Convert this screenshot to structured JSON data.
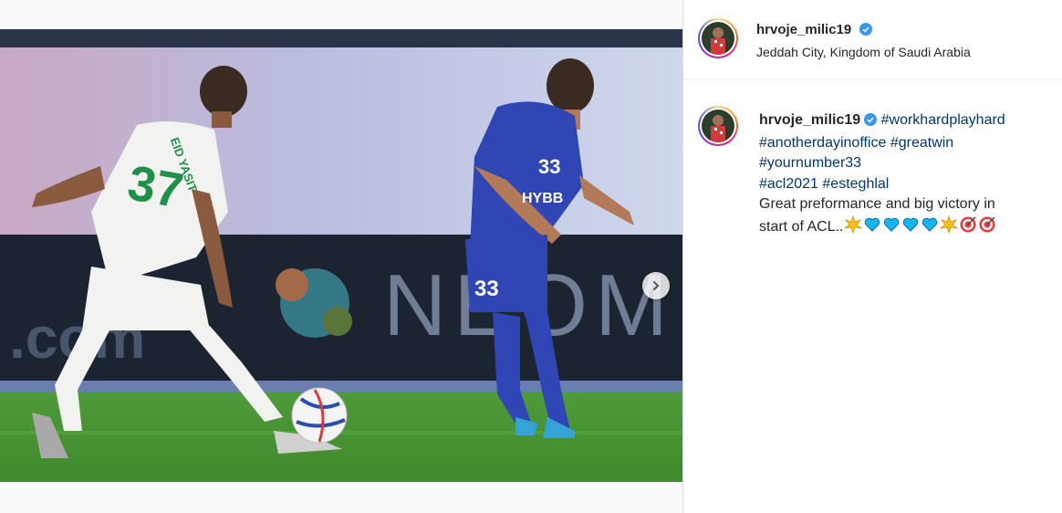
{
  "post": {
    "username": "hrvoje_milic19",
    "location": "Jeddah City, Kingdom of Saudi Arabia",
    "caption": {
      "username": "hrvoje_milic19",
      "hashtags_line1": "#workhardplayhard",
      "hashtags_line2": "#anotherdayinoffice",
      "hashtags_line2b": "#greatwin",
      "hashtags_line3": "#yournumber33",
      "hashtags_line4a": "#acl2021",
      "hashtags_line4b": "#esteghlal",
      "text_line1": "Great preformance and big victory in",
      "text_line2": "start of ACL.."
    },
    "emojis": [
      "burst-emoji",
      "blue-heart-emoji",
      "blue-heart-emoji",
      "blue-heart-emoji",
      "blue-heart-emoji",
      "burst-emoji",
      "target-emoji",
      "target-emoji"
    ]
  },
  "photo": {
    "ad_text_right": "NEOM",
    "ad_text_left": ".com",
    "player_green_number": "37",
    "player_green_name": "EID YASIT",
    "player_blue_number": "33",
    "player_blue_sponsor": "HYBB"
  },
  "carousel": {
    "total": 2,
    "current": 1
  },
  "colors": {
    "link": "#00376b",
    "verified": "#3897f0",
    "divider": "#dbdbdb"
  }
}
